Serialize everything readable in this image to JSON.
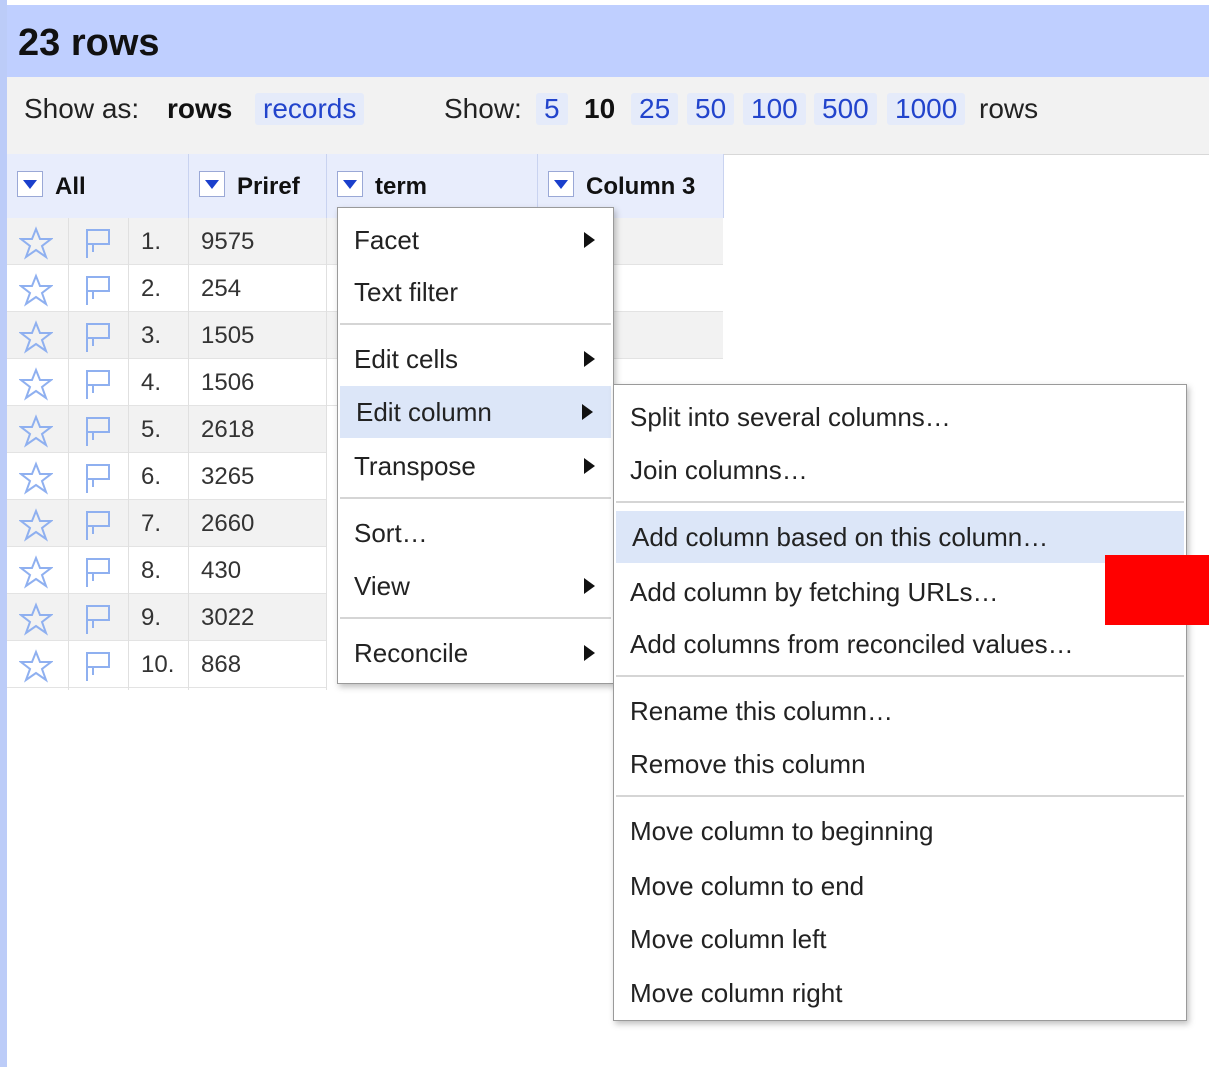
{
  "header": {
    "title": "23 rows"
  },
  "toolbar": {
    "show_as_label": "Show as:",
    "mode_rows": "rows",
    "mode_records": "records",
    "show_label": "Show:",
    "page_sizes": [
      "5",
      "10",
      "25",
      "50",
      "100",
      "500",
      "1000"
    ],
    "selected_page_size": "10",
    "rows_suffix": "rows"
  },
  "columns": [
    "All",
    "Priref",
    "term",
    "Column 3"
  ],
  "rows": [
    {
      "num": "1.",
      "priref": "9575"
    },
    {
      "num": "2.",
      "priref": "254"
    },
    {
      "num": "3.",
      "priref": "1505"
    },
    {
      "num": "4.",
      "priref": "1506"
    },
    {
      "num": "5.",
      "priref": "2618"
    },
    {
      "num": "6.",
      "priref": "3265"
    },
    {
      "num": "7.",
      "priref": "2660"
    },
    {
      "num": "8.",
      "priref": "430"
    },
    {
      "num": "9.",
      "priref": "3022"
    },
    {
      "num": "10.",
      "priref": "868"
    }
  ],
  "column_menu": {
    "items": [
      {
        "label": "Facet",
        "submenu": true
      },
      {
        "label": "Text filter",
        "submenu": false
      },
      {
        "label": "Edit cells",
        "submenu": true
      },
      {
        "label": "Edit column",
        "submenu": true,
        "highlighted": true
      },
      {
        "label": "Transpose",
        "submenu": true
      },
      {
        "label": "Sort…",
        "submenu": false
      },
      {
        "label": "View",
        "submenu": true
      },
      {
        "label": "Reconcile",
        "submenu": true
      }
    ]
  },
  "edit_column_submenu": {
    "items": [
      {
        "label": "Split into several columns…"
      },
      {
        "label": "Join columns…"
      },
      {
        "label": "Add column based on this column…",
        "highlighted": true
      },
      {
        "label": "Add column by fetching URLs…"
      },
      {
        "label": "Add columns from reconciled values…"
      },
      {
        "label": "Rename this column…"
      },
      {
        "label": "Remove this column"
      },
      {
        "label": "Move column to beginning"
      },
      {
        "label": "Move column to end"
      },
      {
        "label": "Move column left"
      },
      {
        "label": "Move column right"
      }
    ]
  },
  "colors": {
    "header_bg": "#bfcfff",
    "highlight_bg": "#dce6f8",
    "link": "#2244cc",
    "redaction": "#ff0000"
  }
}
